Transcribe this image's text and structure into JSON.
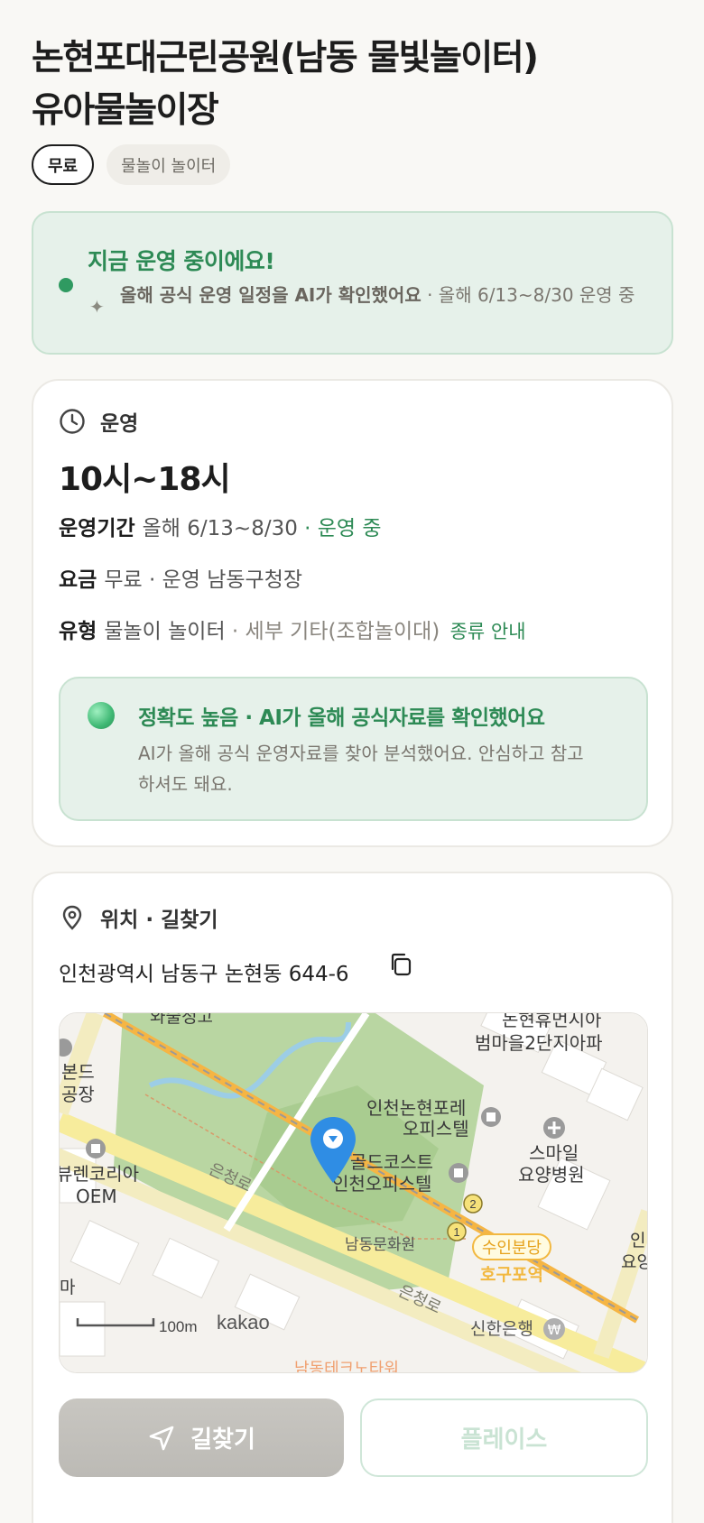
{
  "title": {
    "line1": "논현포대근린공원(남동 물빛놀이터)",
    "line2": "유아물놀이장"
  },
  "tags": [
    "무료",
    "물놀이 놀이터"
  ],
  "status": {
    "title": "지금 운영 중이에요!",
    "sub_bold": "올해 공식 운영 일정을 AI가 확인했어요",
    "sub_rest": " · 올해 6/13~8/30 운영 중"
  },
  "operation": {
    "section_label": "운영",
    "hours": "10시~18시",
    "period_label": "운영기간",
    "period_value": "올해 6/13~8/30",
    "period_status": " · 운영 중",
    "fee_label": "요금",
    "fee_value": "무료 · 운영 남동구청장",
    "type_label": "유형",
    "type_value": "물놀이 놀이터",
    "type_detail": " · 세부 기타(조합놀이대)",
    "type_link": "종류 안내",
    "accuracy_title": "정확도 높음 · AI가 올해 공식자료를 확인했어요",
    "accuracy_desc": "AI가 올해 공식 운영자료를 찾아 분석했어요. 안심하고 참고하셔도 돼요."
  },
  "location": {
    "section_label": "위치 · 길찾기",
    "address": "인천광역시 남동구 논현동 644-6",
    "map": {
      "labels": {
        "top_left": "와술정고",
        "top_right_1": "논현휴먼시아",
        "top_right_2": "범마을2단지아파",
        "left_1": "본드",
        "left_2": "공장",
        "office_1": "인천논현포레",
        "office_2": "오피스텔",
        "goldcoast_1": "골드코스트",
        "goldcoast_2": "인천오피스텔",
        "smile_1": "스마일",
        "smile_2": "요양병원",
        "oem_1": "뷰렌코리아",
        "oem_2": "OEM",
        "road_1": "은청로",
        "road_2": "은청로",
        "culture": "남동문화원",
        "station": "수인분당",
        "station_2": "호구포역",
        "bank": "신한은행",
        "right_1": "인",
        "right_2": "요양",
        "left_ma": "마",
        "bottom": "남동테크노타워",
        "exit_1": "1",
        "exit_2": "2",
        "scale": "100m",
        "brand": "kakao"
      }
    }
  },
  "buttons": {
    "directions": "길찾기",
    "place": "플레이스"
  },
  "colors": {
    "accent_green": "#2d8a55",
    "status_bg": "#e6f1ea",
    "page_bg": "#f9f8f5",
    "map_park": "#b9d6a2",
    "pin_blue": "#2f8de4"
  }
}
